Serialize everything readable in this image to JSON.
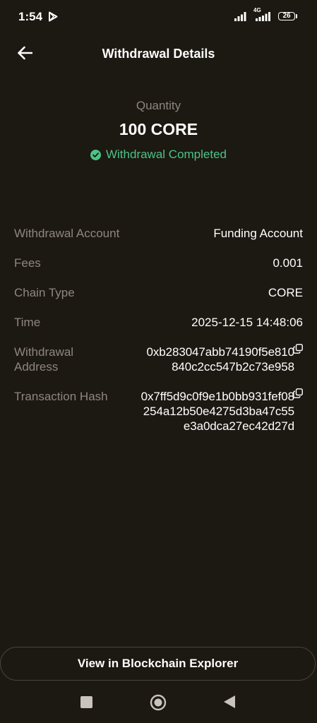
{
  "status_bar": {
    "time": "1:54",
    "network": "4G",
    "battery": "26",
    "icons": [
      "play-store-icon",
      "signal-icon",
      "signal-icon",
      "battery-icon"
    ]
  },
  "header": {
    "title": "Withdrawal Details",
    "back_icon": "arrow-left-icon"
  },
  "summary": {
    "quantity_label": "Quantity",
    "quantity_value": "100 CORE",
    "status_text": "Withdrawal Completed",
    "status_color": "#4cc386"
  },
  "details": {
    "withdrawal_account": {
      "label": "Withdrawal Account",
      "value": "Funding Account"
    },
    "fees": {
      "label": "Fees",
      "value": "0.001"
    },
    "chain_type": {
      "label": "Chain Type",
      "value": "CORE"
    },
    "time": {
      "label": "Time",
      "value": "2025-12-15 14:48:06"
    },
    "withdrawal_address": {
      "label": "Withdrawal Address",
      "value": "0xb283047abb74190f5e810840c2cc547b2c73e958"
    },
    "transaction_hash": {
      "label": "Transaction Hash",
      "value": "0x7ff5d9c0f9e1b0bb931fef08254a12b50e4275d3ba47c55e3a0dca27ec42d27d"
    }
  },
  "actions": {
    "explorer_button": "View in Blockchain Explorer"
  },
  "colors": {
    "background": "#1c1812",
    "label": "#8e877d",
    "success": "#4cc386"
  }
}
